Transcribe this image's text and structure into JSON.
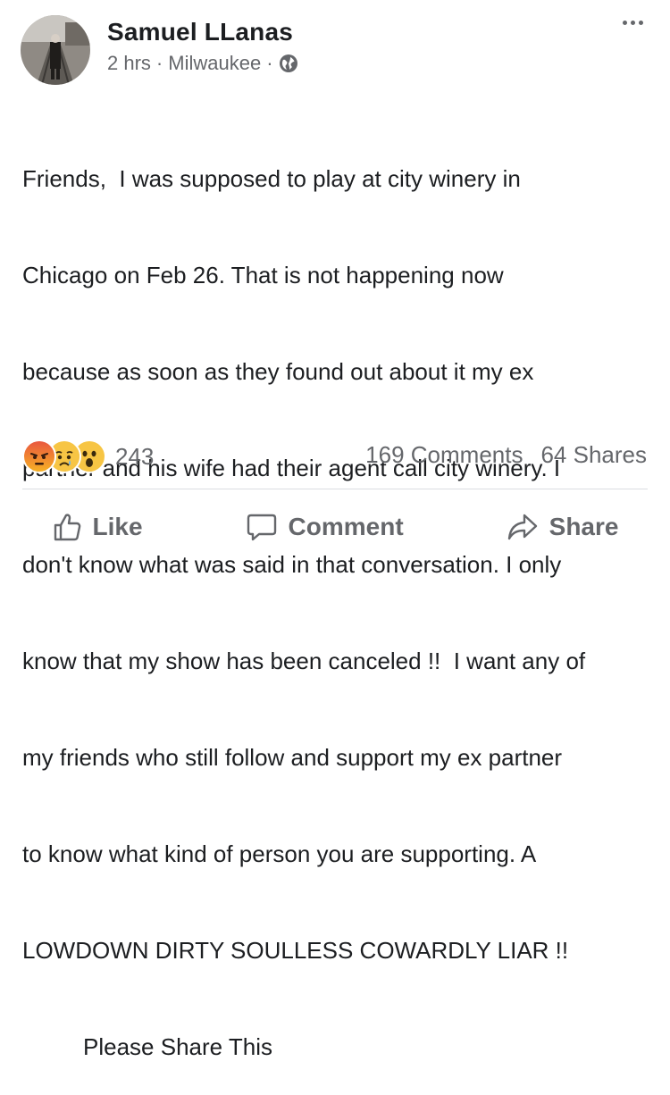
{
  "post": {
    "author": "Samuel LLanas",
    "time": "2 hrs",
    "location": "Milwaukee",
    "separator": "·",
    "privacy_icon": "globe-icon",
    "text_lines": [
      "Friends,  I was supposed to play at city winery in",
      "Chicago on Feb 26. That is not happening now",
      "because as soon as they found out about it my ex",
      "partner and his wife had their agent call city winery. I",
      "don't know what was said in that conversation. I only",
      "know that my show has been canceled !!  I want any of",
      "my friends who still follow and support my ex partner",
      "to know what kind of person you are supporting. A",
      "LOWDOWN DIRTY SOULLESS COWARDLY LIAR !!"
    ],
    "share_line": "Please Share This"
  },
  "reactions": {
    "icons": [
      "angry-emoji-icon",
      "sad-emoji-icon",
      "wow-emoji-icon"
    ],
    "count": "243"
  },
  "stats": {
    "comments": "169 Comments",
    "shares": "64 Shares"
  },
  "actions": {
    "like": "Like",
    "comment": "Comment",
    "share": "Share"
  },
  "colors": {
    "text": "#1c1e21",
    "secondary": "#65676b",
    "divider": "#dadde1"
  }
}
